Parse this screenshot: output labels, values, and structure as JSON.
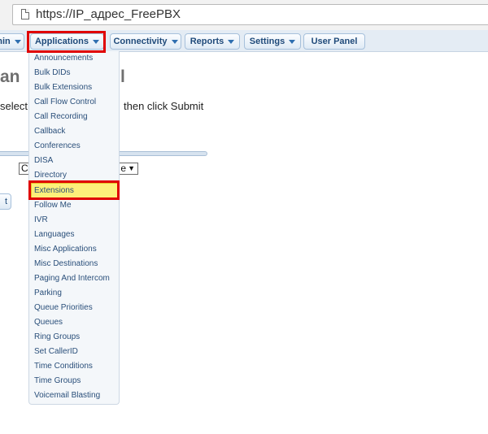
{
  "browser": {
    "url": "https://IP_адрес_FreePBX"
  },
  "nav": {
    "admin_label": "nin",
    "applications_label": "Applications",
    "connectivity_label": "Connectivity",
    "reports_label": "Reports",
    "settings_label": "Settings",
    "user_panel_label": "User Panel",
    "caret_icon": "triangle-down"
  },
  "page": {
    "heading_left": "an",
    "heading_right": "l",
    "instruction_left": "select",
    "instruction_right": "then click Submit",
    "select_left": "C",
    "select_right": "e",
    "select_arrow": "▼",
    "submit_label": "t"
  },
  "applications_menu": {
    "items": [
      "Announcements",
      "Bulk DIDs",
      "Bulk Extensions",
      "Call Flow Control",
      "Call Recording",
      "Callback",
      "Conferences",
      "DISA",
      "Directory",
      "Extensions",
      "Follow Me",
      "IVR",
      "Languages",
      "Misc Applications",
      "Misc Destinations",
      "Paging And Intercom",
      "Parking",
      "Queue Priorities",
      "Queues",
      "Ring Groups",
      "Set CallerID",
      "Time Conditions",
      "Time Groups",
      "Voicemail Blasting"
    ],
    "selected": "Extensions"
  },
  "colors": {
    "highlight_box": "#e00000",
    "selected_item_bg": "#fdf07a",
    "menu_text": "#2a4f7a",
    "nav_text": "#1f4a7a"
  }
}
